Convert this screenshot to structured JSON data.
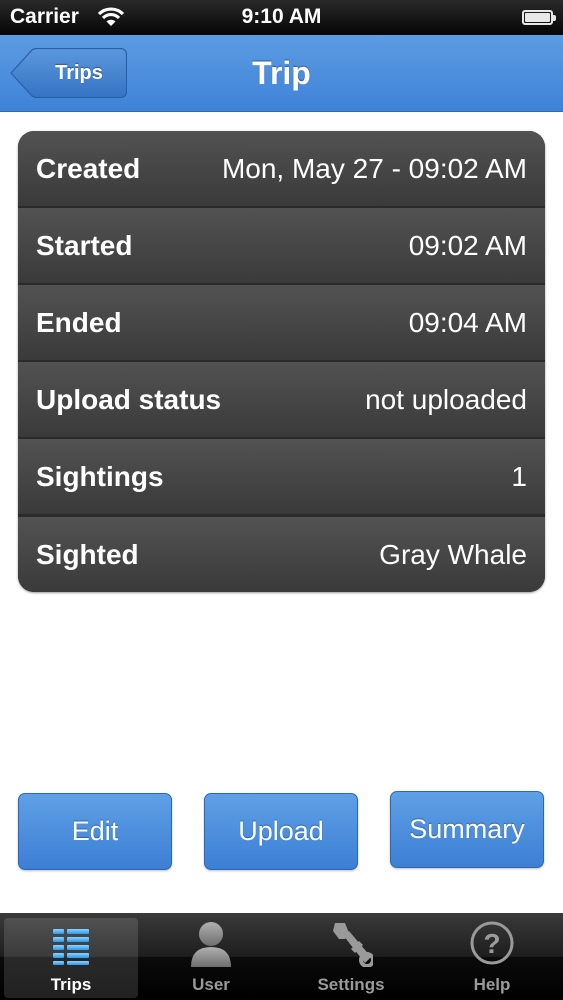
{
  "status_bar": {
    "carrier": "Carrier",
    "time": "9:10 AM"
  },
  "nav": {
    "back_label": "Trips",
    "title": "Trip"
  },
  "details": [
    {
      "label": "Created",
      "value": "Mon, May 27 - 09:02 AM"
    },
    {
      "label": "Started",
      "value": "09:02 AM"
    },
    {
      "label": "Ended",
      "value": "09:04 AM"
    },
    {
      "label": "Upload status",
      "value": "not uploaded"
    },
    {
      "label": "Sightings",
      "value": "1"
    },
    {
      "label": "Sighted",
      "value": "Gray Whale"
    }
  ],
  "actions": {
    "edit": "Edit",
    "upload": "Upload",
    "summary": "Summary"
  },
  "tabs": [
    {
      "label": "Trips",
      "icon": "list-icon",
      "active": true
    },
    {
      "label": "User",
      "icon": "user-icon",
      "active": false
    },
    {
      "label": "Settings",
      "icon": "wrench-icon",
      "active": false
    },
    {
      "label": "Help",
      "icon": "help-icon",
      "active": false
    }
  ],
  "colors": {
    "accent": "#4a8ddd",
    "table_bg": "#3f3f3f",
    "tab_bar_bg": "#111111"
  }
}
